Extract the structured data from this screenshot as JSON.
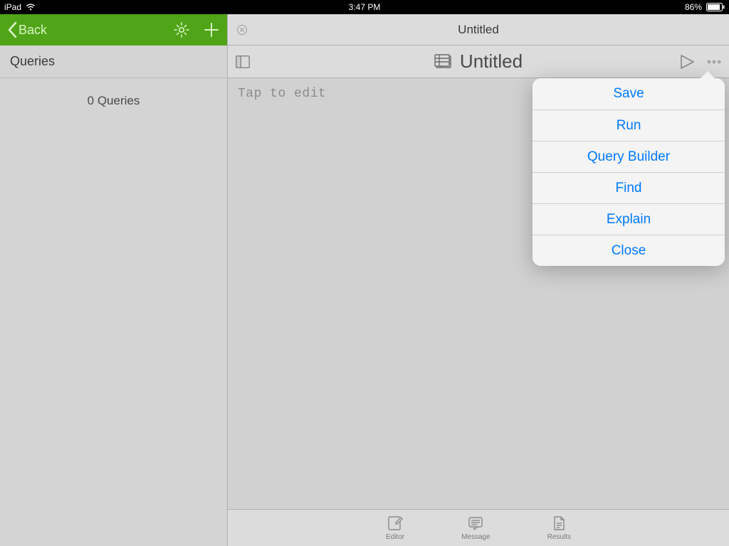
{
  "status_bar": {
    "device": "iPad",
    "time": "3:47 PM",
    "battery_pct": "86%"
  },
  "sidebar": {
    "back_label": "Back",
    "title": "Queries",
    "empty_text": "0 Queries"
  },
  "main": {
    "header_title": "Untitled",
    "doc_title": "Untitled",
    "placeholder": "Tap to edit"
  },
  "popover": {
    "items": [
      "Save",
      "Run",
      "Query Builder",
      "Find",
      "Explain",
      "Close"
    ]
  },
  "tabs": {
    "editor": "Editor",
    "message": "Message",
    "results": "Results"
  }
}
